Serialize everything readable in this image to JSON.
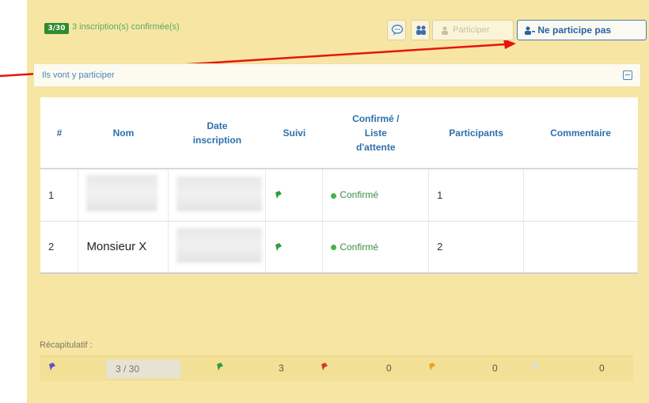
{
  "topbar": {
    "count_badge": "3/30",
    "count_text": "3 inscription(s) confirmée(s)",
    "participe_label": "Participer",
    "not_participate_label": "Ne participe pas"
  },
  "section": {
    "title": "Ils vont y participer"
  },
  "table": {
    "headers": {
      "index": "#",
      "name": "Nom",
      "date_l1": "Date",
      "date_l2": "inscription",
      "suivi": "Suivi",
      "status_l1": "Confirmé /",
      "status_l2": "Liste",
      "status_l3": "d'attente",
      "participants": "Participants",
      "comment": "Commentaire"
    },
    "rows": [
      {
        "index": "1",
        "name": "",
        "status": "Confirmé",
        "participants": "1",
        "comment": ""
      },
      {
        "index": "2",
        "name": "Monsieur X",
        "status": "Confirmé",
        "participants": "2",
        "comment": ""
      }
    ]
  },
  "summary": {
    "label": "Récapitulatif :",
    "total": "3 / 30",
    "green_count": "3",
    "red_count": "0",
    "orange_count": "0",
    "gray_count": "0"
  },
  "colors": {
    "panel_bg": "#f7e6a3",
    "accent_blue": "#2862a3",
    "green": "#2e8b2e",
    "arrow_red": "#e8140c"
  }
}
